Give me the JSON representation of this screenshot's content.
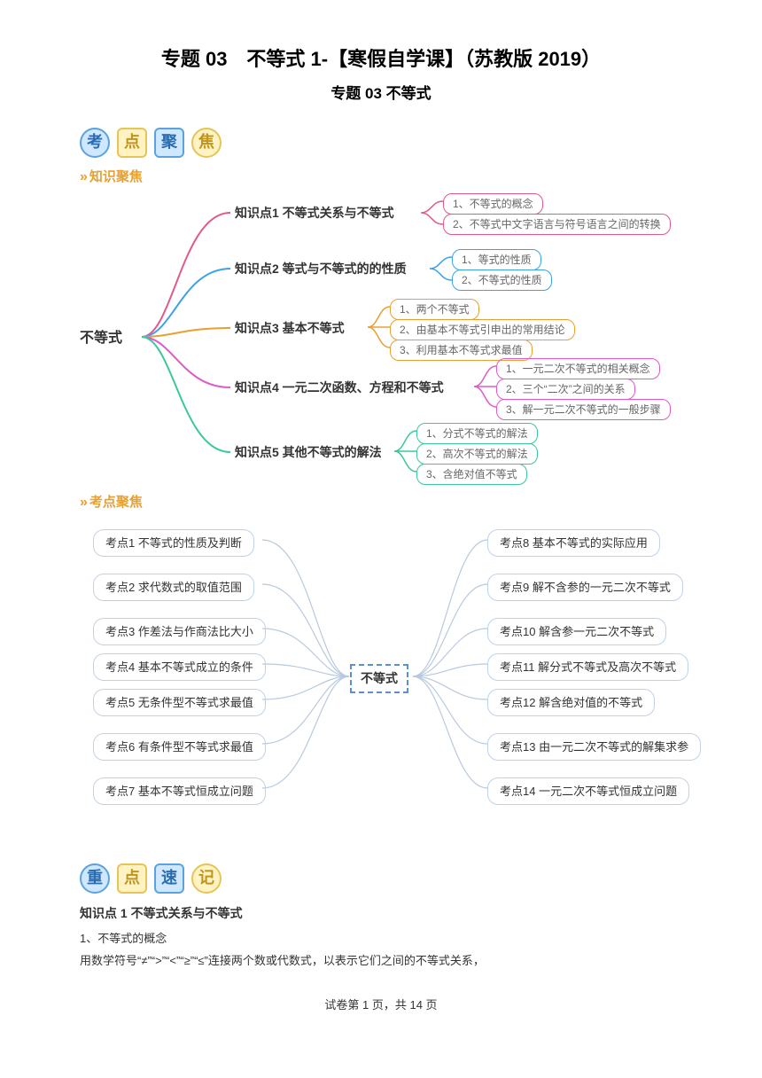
{
  "title_main": "专题 03　不等式 1-【寒假自学课】（苏教版 2019）",
  "title_sub": "专题 03 不等式",
  "section1": {
    "c1": "考",
    "c2": "点",
    "c3": "聚",
    "c4": "焦"
  },
  "h_knowledge": "知识聚焦",
  "mm1": {
    "root": "不等式",
    "topics": [
      "知识点1  不等式关系与不等式",
      "知识点2  等式与不等式的的性质",
      "知识点3  基本不等式",
      "知识点4  一元二次函数、方程和不等式",
      "知识点5  其他不等式的解法"
    ],
    "leaves1": [
      "1、不等式的概念",
      "2、不等式中文字语言与符号语言之间的转换"
    ],
    "leaves2": [
      "1、等式的性质",
      "2、不等式的性质"
    ],
    "leaves3": [
      "1、两个不等式",
      "2、由基本不等式引申出的常用结论",
      "3、利用基本不等式求最值"
    ],
    "leaves4": [
      "1、一元二次不等式的相关概念",
      "2、三个“二次”之间的关系",
      "3、解一元二次不等式的一般步骤"
    ],
    "leaves5": [
      "1、分式不等式的解法",
      "2、高次不等式的解法",
      "3、含绝对值不等式"
    ]
  },
  "h_points": "考点聚焦",
  "mm2": {
    "center": "不等式",
    "left": [
      "考点1  不等式的性质及判断",
      "考点2  求代数式的取值范围",
      "考点3  作差法与作商法比大小",
      "考点4  基本不等式成立的条件",
      "考点5  无条件型不等式求最值",
      "考点6  有条件型不等式求最值",
      "考点7  基本不等式恒成立问题"
    ],
    "right": [
      "考点8  基本不等式的实际应用",
      "考点9  解不含参的一元二次不等式",
      "考点10  解含参一元二次不等式",
      "考点11  解分式不等式及高次不等式",
      "考点12  解含绝对值的不等式",
      "考点13  由一元二次不等式的解集求参",
      "考点14  一元二次不等式恒成立问题"
    ]
  },
  "section2": {
    "c1": "重",
    "c2": "点",
    "c3": "速",
    "c4": "记"
  },
  "kp1_title": "知识点 1 不等式关系与不等式",
  "kp1_1": "1、不等式的概念",
  "kp1_2": "用数学符号“≠”“>”“<”“≥”“≤”连接两个数或代数式，以表示它们之间的不等式关系，",
  "footer": "试卷第 1 页，共 14 页"
}
